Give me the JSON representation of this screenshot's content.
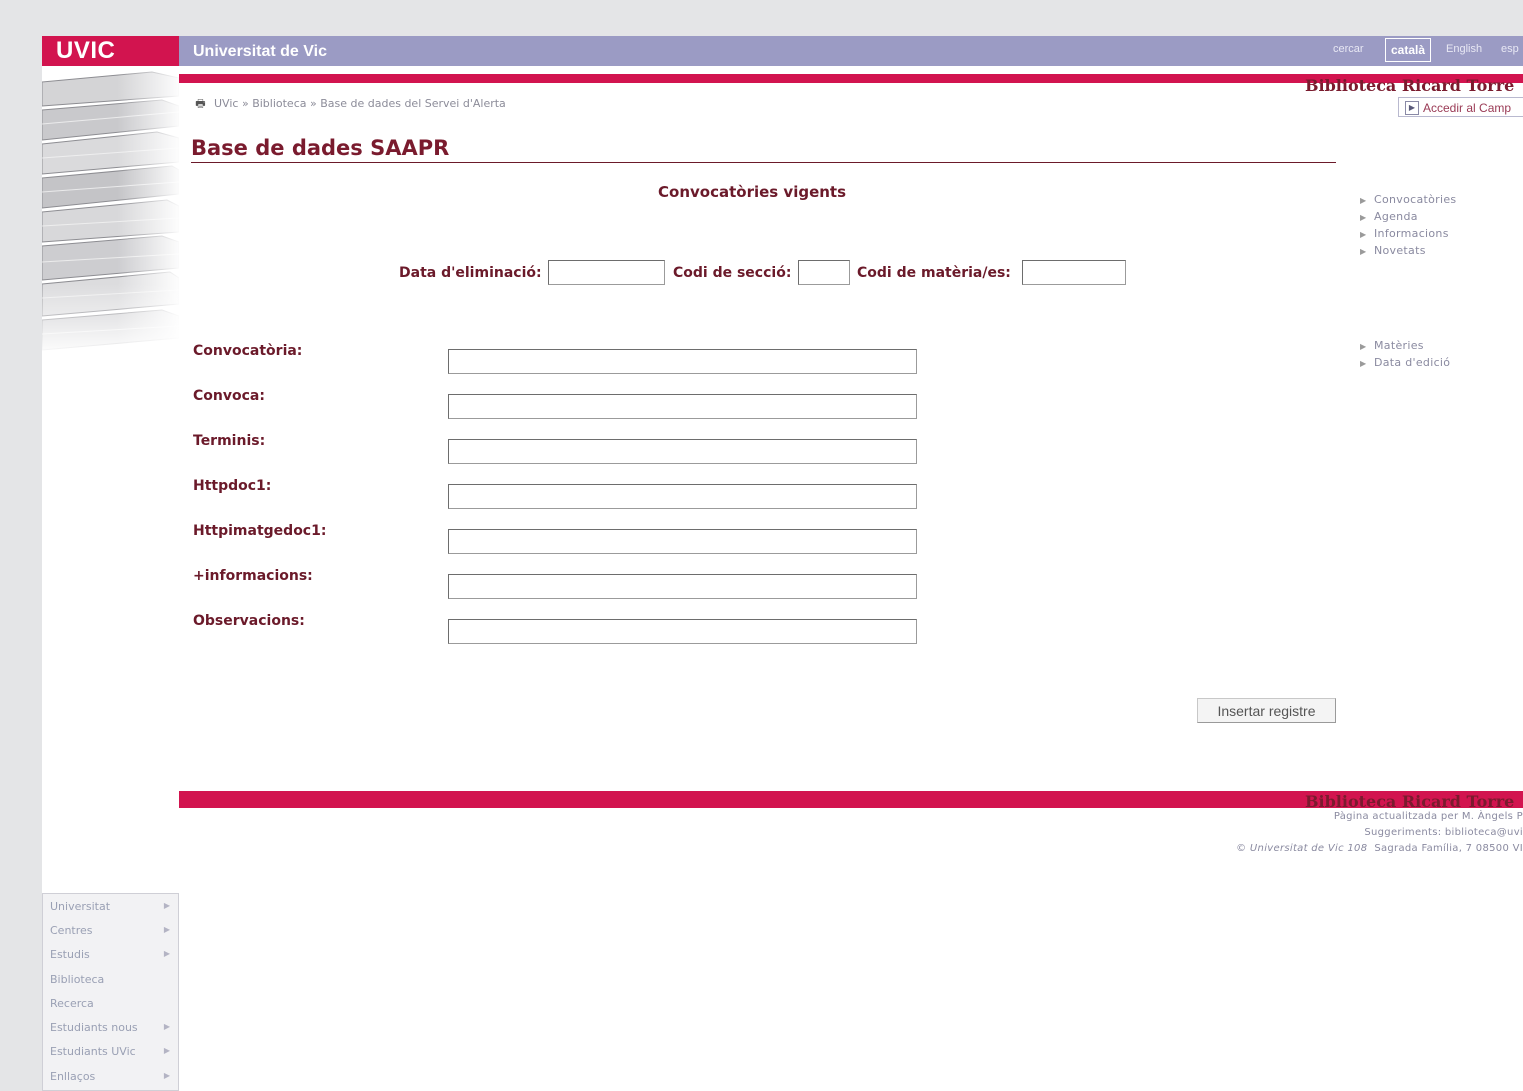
{
  "brand": {
    "logo_text": "UVIC",
    "site_title": "Universitat de Vic"
  },
  "header": {
    "search_label": "cercar",
    "lang_catala": "català",
    "lang_english": "English",
    "lang_espanol": "esp"
  },
  "library_title": "Biblioteca Ricard Torre",
  "campus_button": "Accedir al Camp",
  "breadcrumb": {
    "item1": "UVic",
    "sep": "»",
    "item2": "Biblioteca",
    "item3": "Base de dades del Servei d'Alerta"
  },
  "page_title": "Base de dades SAAPR",
  "subtitle": "Convocatòries vigents",
  "filters": {
    "data_eliminacio_label": "Data d'eliminació:",
    "codi_seccio_label": "Codi de secció:",
    "codi_materia_label": "Codi de matèria/es:"
  },
  "fields": [
    {
      "label": "Convocatòria:",
      "value": ""
    },
    {
      "label": "Convoca:",
      "value": ""
    },
    {
      "label": "Terminis:",
      "value": ""
    },
    {
      "label": "Httpdoc1:",
      "value": ""
    },
    {
      "label": "Httpimatgedoc1:",
      "value": ""
    },
    {
      "label": "+informacions:",
      "value": ""
    },
    {
      "label": "Observacions:",
      "value": ""
    }
  ],
  "insert_button": "Insertar registre",
  "side_links_1": [
    "Convocatòries",
    "Agenda",
    "Informacions",
    "Novetats"
  ],
  "side_links_2": [
    "Matèries",
    "Data d'edició"
  ],
  "footer": {
    "title": "Biblioteca Ricard Torre",
    "line1": "Pàgina actualitzada per M. Àngels P",
    "line2": "Suggeriments: biblioteca@uvi",
    "line3_italic": "© Universitat de Vic 108",
    "line3_rest": "Sagrada Família, 7 08500 VI"
  },
  "left_nav": [
    "Universitat",
    "Centres",
    "Estudis",
    "Biblioteca",
    "Recerca",
    "Estudiants nous",
    "Estudiants UVic",
    "Enllaços"
  ],
  "colors": {
    "accent": "#d2144f",
    "header": "#9b9bc4",
    "text": "#6b1a2a"
  }
}
